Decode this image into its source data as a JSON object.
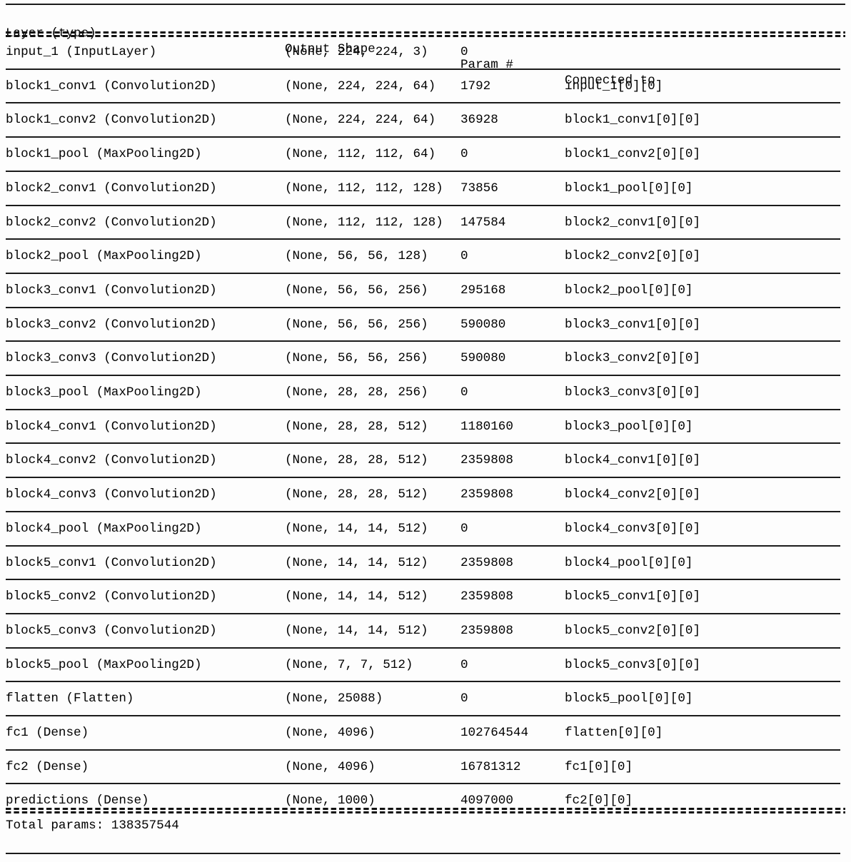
{
  "table": {
    "headers": {
      "layer": "Layer (type)",
      "shape": "Output Shape",
      "param": "Param #",
      "connected": "Connected to"
    },
    "separator_glyph": "====================================================================================================",
    "rows": [
      {
        "layer": "input_1 (InputLayer)",
        "shape": "(None, 224, 224, 3)",
        "param": "0",
        "connected": ""
      },
      {
        "layer": "block1_conv1 (Convolution2D)",
        "shape": "(None, 224, 224, 64)",
        "param": "1792",
        "connected": "input_1[0][0]"
      },
      {
        "layer": "block1_conv2 (Convolution2D)",
        "shape": "(None, 224, 224, 64)",
        "param": "36928",
        "connected": "block1_conv1[0][0]"
      },
      {
        "layer": "block1_pool (MaxPooling2D)",
        "shape": "(None, 112, 112, 64)",
        "param": "0",
        "connected": "block1_conv2[0][0]"
      },
      {
        "layer": "block2_conv1 (Convolution2D)",
        "shape": "(None, 112, 112, 128)",
        "param": "73856",
        "connected": "block1_pool[0][0]"
      },
      {
        "layer": "block2_conv2 (Convolution2D)",
        "shape": "(None, 112, 112, 128)",
        "param": "147584",
        "connected": "block2_conv1[0][0]"
      },
      {
        "layer": "block2_pool (MaxPooling2D)",
        "shape": "(None, 56, 56, 128)",
        "param": "0",
        "connected": "block2_conv2[0][0]"
      },
      {
        "layer": "block3_conv1 (Convolution2D)",
        "shape": "(None, 56, 56, 256)",
        "param": "295168",
        "connected": "block2_pool[0][0]"
      },
      {
        "layer": "block3_conv2 (Convolution2D)",
        "shape": "(None, 56, 56, 256)",
        "param": "590080",
        "connected": "block3_conv1[0][0]"
      },
      {
        "layer": "block3_conv3 (Convolution2D)",
        "shape": "(None, 56, 56, 256)",
        "param": "590080",
        "connected": "block3_conv2[0][0]"
      },
      {
        "layer": "block3_pool (MaxPooling2D)",
        "shape": "(None, 28, 28, 256)",
        "param": "0",
        "connected": "block3_conv3[0][0]"
      },
      {
        "layer": "block4_conv1 (Convolution2D)",
        "shape": "(None, 28, 28, 512)",
        "param": "1180160",
        "connected": "block3_pool[0][0]"
      },
      {
        "layer": "block4_conv2 (Convolution2D)",
        "shape": "(None, 28, 28, 512)",
        "param": "2359808",
        "connected": "block4_conv1[0][0]"
      },
      {
        "layer": "block4_conv3 (Convolution2D)",
        "shape": "(None, 28, 28, 512)",
        "param": "2359808",
        "connected": "block4_conv2[0][0]"
      },
      {
        "layer": "block4_pool (MaxPooling2D)",
        "shape": "(None, 14, 14, 512)",
        "param": "0",
        "connected": "block4_conv3[0][0]"
      },
      {
        "layer": "block5_conv1 (Convolution2D)",
        "shape": "(None, 14, 14, 512)",
        "param": "2359808",
        "connected": "block4_pool[0][0]"
      },
      {
        "layer": "block5_conv2 (Convolution2D)",
        "shape": "(None, 14, 14, 512)",
        "param": "2359808",
        "connected": "block5_conv1[0][0]"
      },
      {
        "layer": "block5_conv3 (Convolution2D)",
        "shape": "(None, 14, 14, 512)",
        "param": "2359808",
        "connected": "block5_conv2[0][0]"
      },
      {
        "layer": "block5_pool (MaxPooling2D)",
        "shape": "(None, 7, 7, 512)",
        "param": "0",
        "connected": "block5_conv3[0][0]"
      },
      {
        "layer": "flatten (Flatten)",
        "shape": "(None, 25088)",
        "param": "0",
        "connected": "block5_pool[0][0]"
      },
      {
        "layer": "fc1 (Dense)",
        "shape": "(None, 4096)",
        "param": "102764544",
        "connected": "flatten[0][0]"
      },
      {
        "layer": "fc2 (Dense)",
        "shape": "(None, 4096)",
        "param": "16781312",
        "connected": "fc1[0][0]"
      },
      {
        "layer": "predictions (Dense)",
        "shape": "(None, 1000)",
        "param": "4097000",
        "connected": "fc2[0][0]"
      }
    ],
    "total_params": "Total params: 138357544"
  }
}
